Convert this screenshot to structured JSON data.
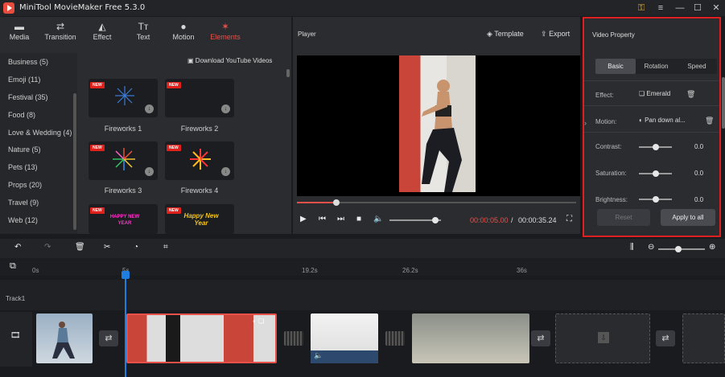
{
  "app": {
    "title": "MiniTool MovieMaker Free 5.3.0"
  },
  "toolbar": {
    "items": [
      {
        "label": "Media",
        "icon": "folder-icon"
      },
      {
        "label": "Transition",
        "icon": "transition-icon"
      },
      {
        "label": "Effect",
        "icon": "effect-icon"
      },
      {
        "label": "Text",
        "icon": "text-icon"
      },
      {
        "label": "Motion",
        "icon": "motion-icon"
      },
      {
        "label": "Elements",
        "icon": "elements-icon"
      }
    ],
    "active": "Elements",
    "accent": "#e8504a"
  },
  "elements": {
    "download_youtube": "Download YouTube Videos",
    "categories": [
      "Business (5)",
      "Emoji (11)",
      "Festival (35)",
      "Food (8)",
      "Love & Wedding (4)",
      "Nature (5)",
      "Pets (13)",
      "Props (20)",
      "Travel (9)",
      "Web (12)"
    ],
    "cards": [
      {
        "label": "Fireworks 1",
        "badge": "NEW"
      },
      {
        "label": "Fireworks 2",
        "badge": "NEW"
      },
      {
        "label": "Fireworks 3",
        "badge": "NEW"
      },
      {
        "label": "Fireworks 4",
        "badge": "NEW"
      },
      {
        "label": "",
        "badge": "NEW",
        "art_text": "HAPPY NEW YEAR"
      },
      {
        "label": "",
        "badge": "NEW",
        "art_text": "Happy New Year"
      }
    ]
  },
  "player": {
    "title": "Player",
    "template_label": "Template",
    "export_label": "Export",
    "current_time": "00:00:05.00",
    "separator": " / ",
    "total_time": "00:00:35.24",
    "progress_fraction": 0.14,
    "volume_fraction": 0.7
  },
  "video_property": {
    "title": "Video Property",
    "tabs": [
      "Basic",
      "Rotation",
      "Speed"
    ],
    "active_tab": "Basic",
    "effect_label": "Effect:",
    "effect_value": "Emerald",
    "motion_label": "Motion:",
    "motion_value": "Pan down al...",
    "sliders": [
      {
        "label": "Contrast:",
        "value": "0.0"
      },
      {
        "label": "Saturation:",
        "value": "0.0"
      },
      {
        "label": "Brightness:",
        "value": "0.0"
      }
    ],
    "reset_label": "Reset",
    "apply_label": "Apply to all",
    "highlight_color": "#e02020"
  },
  "timeline": {
    "ruler": [
      "0s",
      "5s",
      "19.2s",
      "26.2s",
      "36s"
    ],
    "track_label": "Track1",
    "playhead_color": "#1e7fe0"
  }
}
